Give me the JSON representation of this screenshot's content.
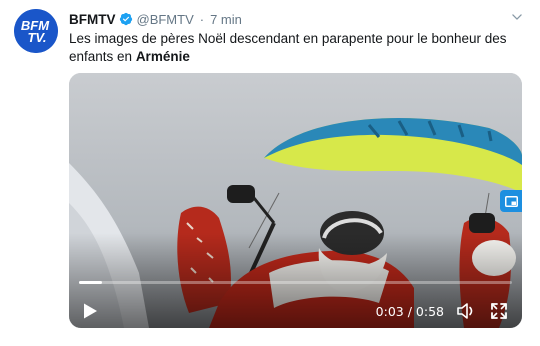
{
  "tweet": {
    "account_name": "BFMTV",
    "handle": "@BFMTV",
    "separator": "·",
    "time": "7 min",
    "text_plain": "Les images de pères Noël descendant en parapente pour le bonheur des enfants en ",
    "text_bold": "Arménie",
    "avatar_text_line1": "BFM",
    "avatar_text_line2": "TV.",
    "verified_icon": "verified-badge-icon",
    "menu_icon": "chevron-down-icon"
  },
  "video": {
    "current_time": "0:03",
    "time_separator": " / ",
    "duration": "0:58",
    "progress_fraction": 0.052,
    "controls_icons": [
      "play-icon",
      "volume-icon",
      "fullscreen-icon",
      "picture-in-picture-icon"
    ]
  },
  "colors": {
    "brand_blue": "#1a56c9",
    "verified_blue": "#1da1f2",
    "handle_gray": "#657786",
    "text_dark": "#14171a",
    "pip_blue": "#1d8fe0"
  }
}
